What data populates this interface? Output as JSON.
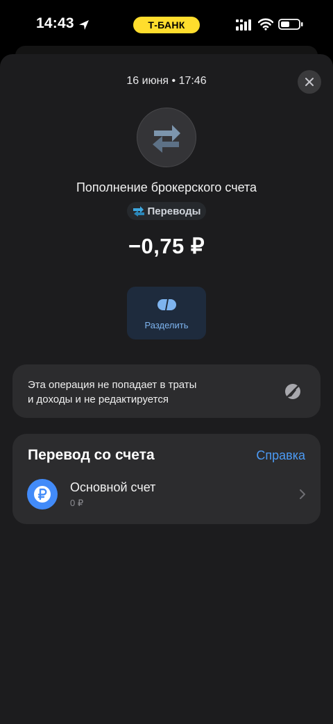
{
  "status_bar": {
    "time": "14:43",
    "carrier": "Т-БАНК",
    "carrier_color": "#ffdd2d"
  },
  "sheet": {
    "date": "16 июня • 17:46",
    "close_icon": "close-icon"
  },
  "operation": {
    "icon": "transfer-arrows-icon",
    "title": "Пополнение брокерского счета",
    "category": "Переводы",
    "amount": "−0,75 ₽"
  },
  "actions": {
    "split_label": "Разделить"
  },
  "info": {
    "line1": "Эта операция не попадает в траты",
    "line2": "и доходы и не редактируется",
    "icon": "no-edit-icon"
  },
  "account_section": {
    "heading": "Перевод со счета",
    "help_label": "Справка",
    "account_name": "Основной счет",
    "account_balance": "0 ₽",
    "account_icon": "ruble-icon"
  },
  "colors": {
    "accent_blue": "#4c9bf5",
    "background": "#1c1c1e",
    "card": "#2c2c2e"
  }
}
